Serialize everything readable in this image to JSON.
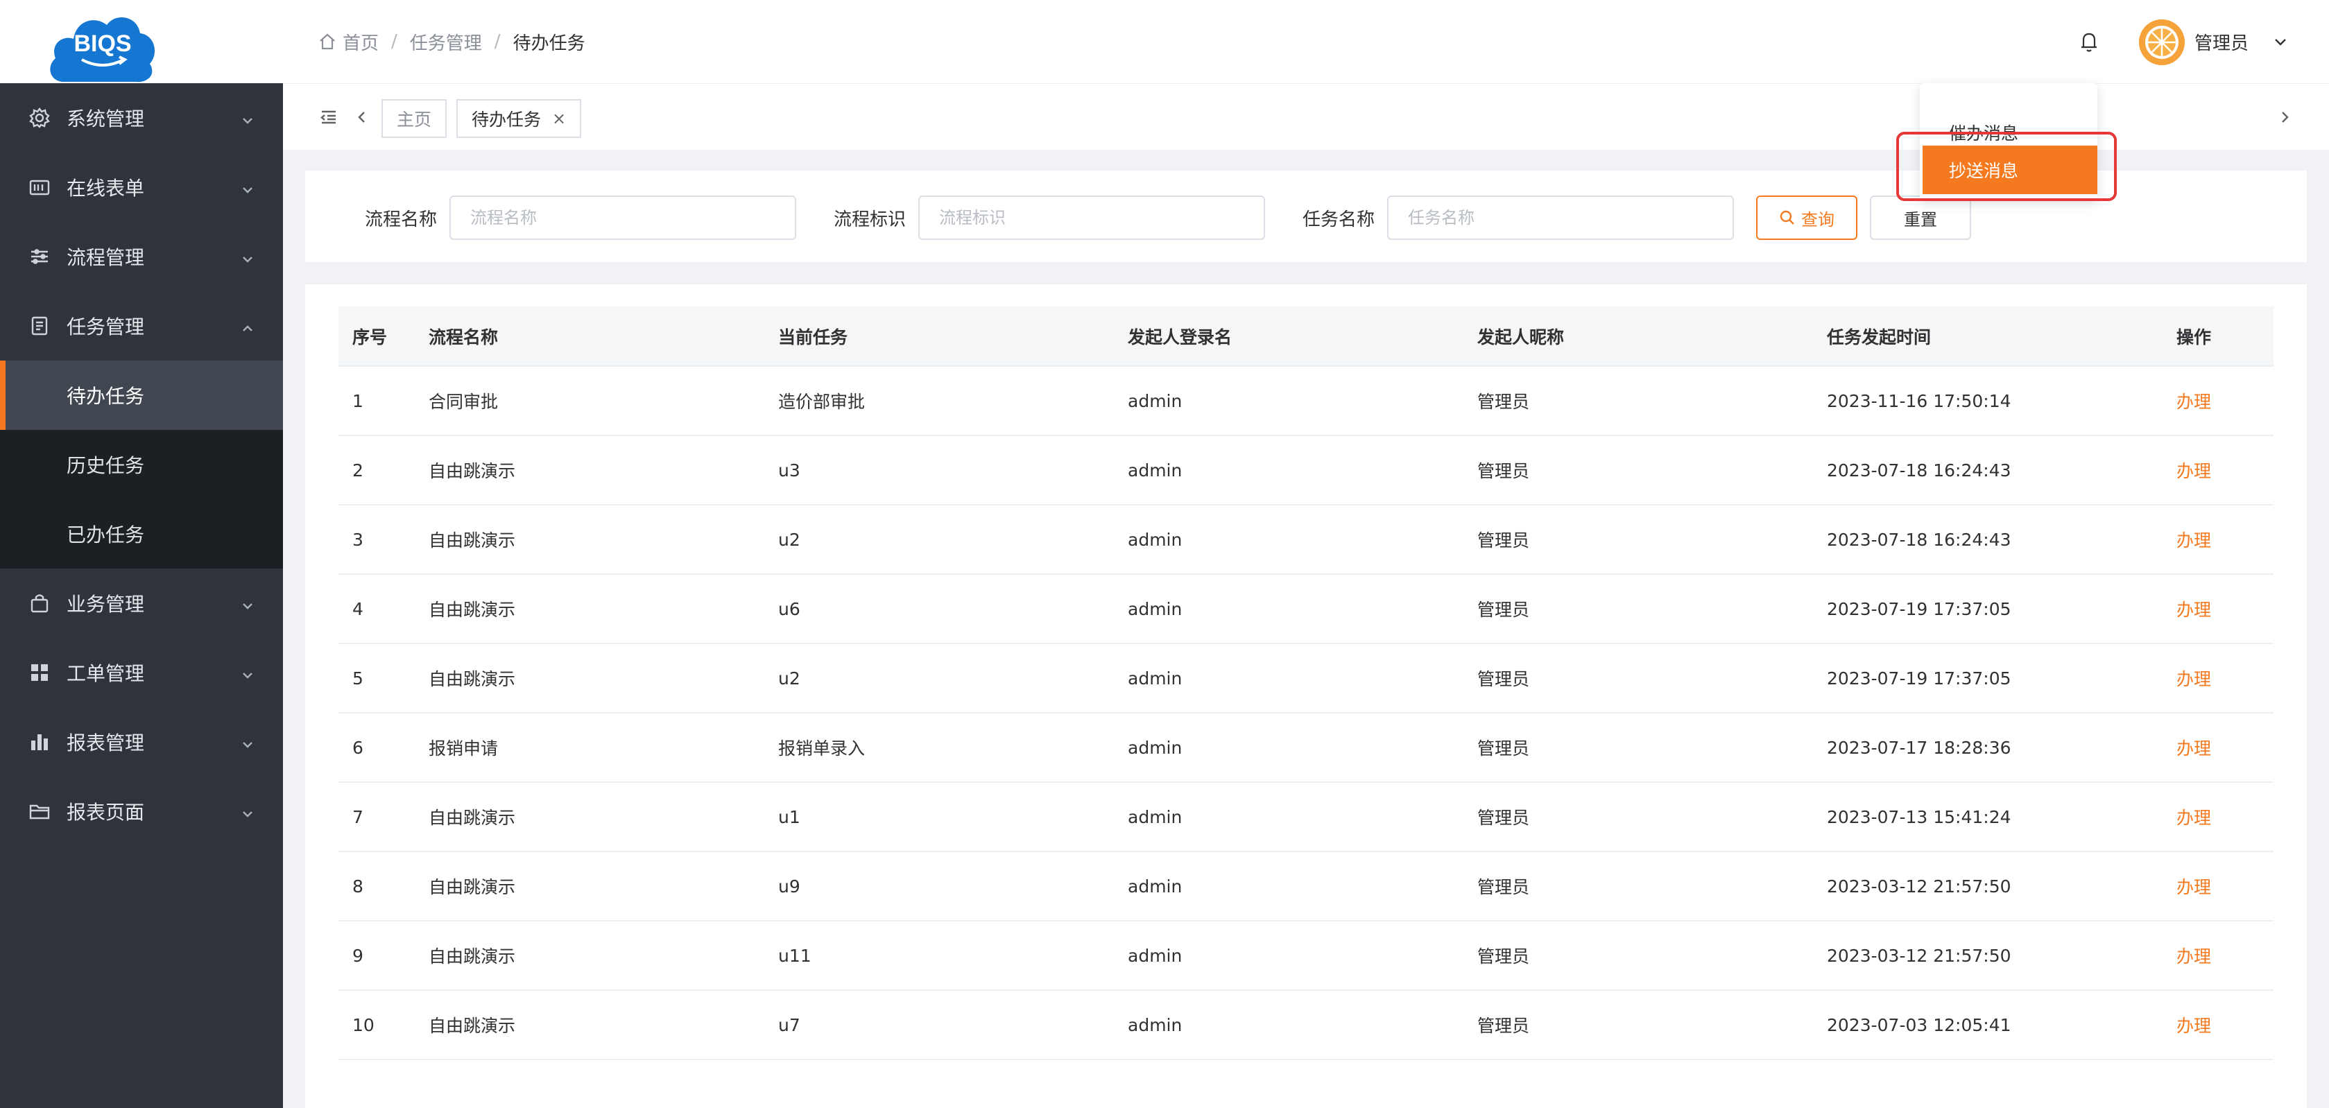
{
  "logo": {
    "text": "BIQS",
    "brand_color": "#1677d2"
  },
  "sidebar": {
    "items": [
      {
        "label": "系统管理",
        "icon": "gear-icon"
      },
      {
        "label": "在线表单",
        "icon": "form-icon"
      },
      {
        "label": "流程管理",
        "icon": "sliders-icon"
      },
      {
        "label": "任务管理",
        "icon": "document-icon",
        "expanded": true
      },
      {
        "label": "业务管理",
        "icon": "bag-icon"
      },
      {
        "label": "工单管理",
        "icon": "grid-icon"
      },
      {
        "label": "报表管理",
        "icon": "bar-chart-icon"
      },
      {
        "label": "报表页面",
        "icon": "folder-icon"
      }
    ],
    "task_submenu": [
      {
        "label": "待办任务",
        "active": true
      },
      {
        "label": "历史任务"
      },
      {
        "label": "已办任务"
      }
    ]
  },
  "header": {
    "breadcrumb": [
      "首页",
      "任务管理",
      "待办任务"
    ],
    "user_name": "管理员"
  },
  "tabs": {
    "home": "主页",
    "current": "待办任务",
    "close_glyph": "×"
  },
  "filters": {
    "process_name": {
      "label": "流程名称",
      "placeholder": "流程名称"
    },
    "process_key": {
      "label": "流程标识",
      "placeholder": "流程标识"
    },
    "task_name": {
      "label": "任务名称",
      "placeholder": "任务名称"
    },
    "search_label": "查询",
    "reset_label": "重置"
  },
  "dropdown": {
    "urge": "催办消息",
    "copy": "抄送消息"
  },
  "table": {
    "columns": [
      "序号",
      "流程名称",
      "当前任务",
      "发起人登录名",
      "发起人昵称",
      "任务发起时间",
      "操作"
    ],
    "rows": [
      [
        "1",
        "合同审批",
        "造价部审批",
        "admin",
        "管理员",
        "2023-11-16 17:50:14",
        "办理"
      ],
      [
        "2",
        "自由跳演示",
        "u3",
        "admin",
        "管理员",
        "2023-07-18 16:24:43",
        "办理"
      ],
      [
        "3",
        "自由跳演示",
        "u2",
        "admin",
        "管理员",
        "2023-07-18 16:24:43",
        "办理"
      ],
      [
        "4",
        "自由跳演示",
        "u6",
        "admin",
        "管理员",
        "2023-07-19 17:37:05",
        "办理"
      ],
      [
        "5",
        "自由跳演示",
        "u2",
        "admin",
        "管理员",
        "2023-07-19 17:37:05",
        "办理"
      ],
      [
        "6",
        "报销申请",
        "报销单录入",
        "admin",
        "管理员",
        "2023-07-17 18:28:36",
        "办理"
      ],
      [
        "7",
        "自由跳演示",
        "u1",
        "admin",
        "管理员",
        "2023-07-13 15:41:24",
        "办理"
      ],
      [
        "8",
        "自由跳演示",
        "u9",
        "admin",
        "管理员",
        "2023-03-12 21:57:50",
        "办理"
      ],
      [
        "9",
        "自由跳演示",
        "u11",
        "admin",
        "管理员",
        "2023-03-12 21:57:50",
        "办理"
      ],
      [
        "10",
        "自由跳演示",
        "u7",
        "admin",
        "管理员",
        "2023-07-03 12:05:41",
        "办理"
      ]
    ]
  },
  "colors": {
    "accent": "#f57a1f",
    "sidebar_bg": "#2e333c",
    "submenu_bg": "#1c1f24",
    "highlight": "#e53935"
  }
}
